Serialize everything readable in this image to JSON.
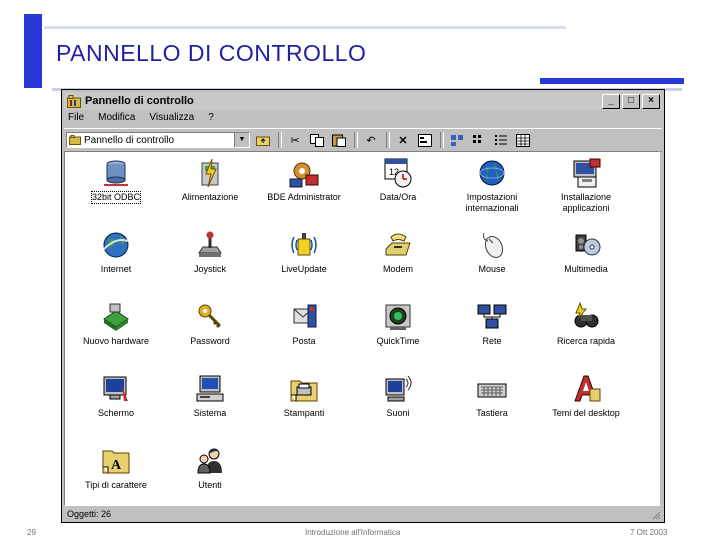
{
  "slide": {
    "title": "PANNELLO DI CONTROLLO",
    "page_number": "29",
    "footer_center": "Introduzione all'Informatica",
    "date": "7 Ott 2003"
  },
  "window": {
    "title": "Pannello di controllo",
    "buttons": {
      "minimize": "_",
      "maximize": "□",
      "close": "×"
    },
    "menu": [
      "File",
      "Modifica",
      "Visualizza",
      "?"
    ],
    "address": {
      "value": "Pannello di controllo"
    },
    "toolbar_icons": [
      "up-folder-icon",
      "cut-icon",
      "copy-icon",
      "paste-icon",
      "undo-icon",
      "delete-icon",
      "properties-icon",
      "large-icons-view-icon",
      "small-icons-view-icon",
      "list-view-icon",
      "details-view-icon"
    ],
    "items": [
      {
        "label": "32bit ODBC",
        "icon": "odbc-icon"
      },
      {
        "label": "Alimentazione",
        "icon": "power-icon"
      },
      {
        "label": "BDE Administrator",
        "icon": "bde-admin-icon"
      },
      {
        "label": "Data/Ora",
        "icon": "calendar-clock-icon"
      },
      {
        "label": "Impostazioni\ninternazionali",
        "icon": "globe-icon"
      },
      {
        "label": "Installazione\napplicazioni",
        "icon": "install-programs-icon"
      },
      {
        "label": "Internet",
        "icon": "internet-icon"
      },
      {
        "label": "Joystick",
        "icon": "joystick-icon"
      },
      {
        "label": "LiveUpdate",
        "icon": "liveupdate-icon"
      },
      {
        "label": "Modem",
        "icon": "modem-icon"
      },
      {
        "label": "Mouse",
        "icon": "mouse-icon"
      },
      {
        "label": "Multimedia",
        "icon": "multimedia-icon"
      },
      {
        "label": "Nuovo hardware",
        "icon": "new-hardware-icon"
      },
      {
        "label": "Password",
        "icon": "password-keys-icon"
      },
      {
        "label": "Posta",
        "icon": "mail-icon"
      },
      {
        "label": "QuickTime",
        "icon": "quicktime-icon"
      },
      {
        "label": "Rete",
        "icon": "network-icon"
      },
      {
        "label": "Ricerca rapida",
        "icon": "find-fast-icon"
      },
      {
        "label": "Schermo",
        "icon": "display-icon"
      },
      {
        "label": "Sistema",
        "icon": "system-computer-icon"
      },
      {
        "label": "Stampanti",
        "icon": "printers-icon"
      },
      {
        "label": "Suoni",
        "icon": "sounds-icon"
      },
      {
        "label": "Tastiera",
        "icon": "keyboard-icon"
      },
      {
        "label": "Temi del desktop",
        "icon": "desktop-themes-icon"
      },
      {
        "label": "Tipi di carattere",
        "icon": "fonts-folder-icon"
      },
      {
        "label": "Utenti",
        "icon": "users-icon"
      }
    ],
    "status": "Oggetti: 26"
  }
}
